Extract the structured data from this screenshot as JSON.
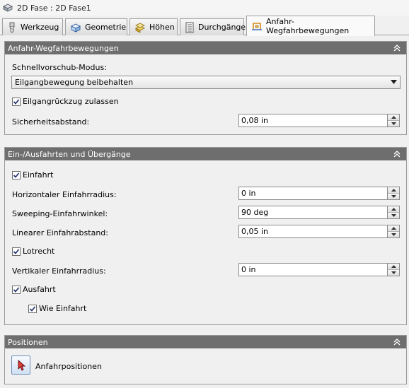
{
  "window": {
    "title": "2D Fase : 2D Fase1"
  },
  "tabs": [
    {
      "label": "Werkzeug"
    },
    {
      "label": "Geometrie"
    },
    {
      "label": "Höhen"
    },
    {
      "label": "Durchgänge"
    },
    {
      "label": "Anfahr-Wegfahrbewegungen",
      "active": true
    }
  ],
  "section_approach": {
    "title": "Anfahr-Wegfahrbewegungen",
    "rapid_mode_label": "Schnellvorschub-Modus:",
    "rapid_mode_value": "Eilgangbewegung beibehalten",
    "allow_rapid_retract": {
      "label": "Eilgangrückzug zulassen",
      "checked": true
    },
    "safe_distance": {
      "label": "Sicherheitsabstand:",
      "value": "0,08 in"
    }
  },
  "section_leads": {
    "title": "Ein-/Ausfahrten und Übergänge",
    "lead_in": {
      "label": "Einfahrt",
      "checked": true
    },
    "horizontal_radius": {
      "label": "Horizontaler Einfahrradius:",
      "value": "0 in"
    },
    "sweep_angle": {
      "label": "Sweeping-Einfahrwinkel:",
      "value": "90 deg"
    },
    "linear_distance": {
      "label": "Linearer Einfahrabstand:",
      "value": "0,05 in"
    },
    "perpendicular": {
      "label": "Lotrecht",
      "checked": true
    },
    "vertical_radius": {
      "label": "Vertikaler Einfahrradius:",
      "value": "0 in"
    },
    "lead_out": {
      "label": "Ausfahrt",
      "checked": true
    },
    "same_as_lead_in": {
      "label": "Wie Einfahrt",
      "checked": true
    }
  },
  "section_positions": {
    "title": "Positionen",
    "approach_positions_label": "Anfahrpositionen"
  },
  "colors": {
    "header": "#6e6e6e",
    "background": "#f0f0f0"
  }
}
